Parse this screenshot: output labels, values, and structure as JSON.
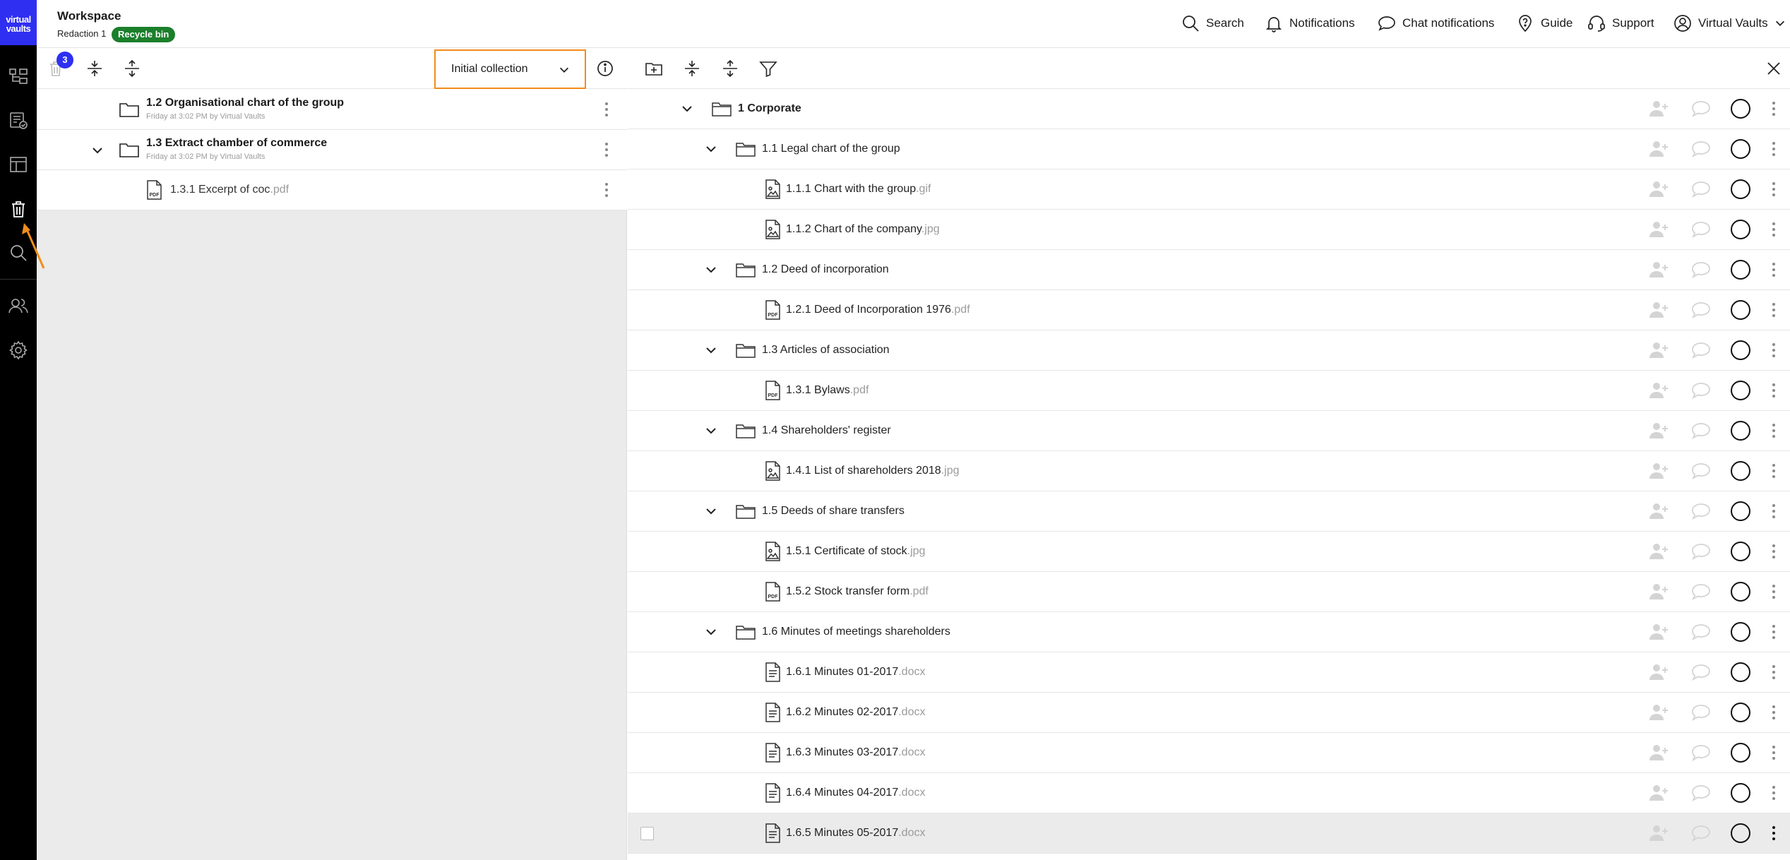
{
  "app": {
    "logo_line1": "virtual",
    "logo_line2": "vaults",
    "workspace_title": "Workspace",
    "workspace_sub": "Redaction 1",
    "workspace_badge": "Recycle bin"
  },
  "header_nav": {
    "search": "Search",
    "notifications": "Notifications",
    "chat_notifications": "Chat notifications",
    "guide": "Guide",
    "support": "Support",
    "account": "Virtual Vaults"
  },
  "left_toolbar": {
    "bin_count": "3",
    "collection_selected": "Initial collection"
  },
  "left_rows": [
    {
      "title": "1.2 Organisational chart of the group",
      "meta": "Friday at 3:02 PM by Virtual Vaults"
    },
    {
      "title": "1.3 Extract chamber of commerce",
      "meta": "Friday at 3:02 PM by Virtual Vaults"
    },
    {
      "name": "1.3.1 Excerpt of coc",
      "ext": ".pdf"
    }
  ],
  "tree": [
    {
      "name": "1 Corporate",
      "ext": "",
      "type": "folder",
      "level": 0
    },
    {
      "name": "1.1 Legal chart of the group",
      "ext": "",
      "type": "folder",
      "level": 1
    },
    {
      "name": "1.1.1 Chart with the group",
      "ext": ".gif",
      "type": "image",
      "level": 2
    },
    {
      "name": "1.1.2 Chart of the company",
      "ext": ".jpg",
      "type": "image",
      "level": 2
    },
    {
      "name": "1.2 Deed of incorporation",
      "ext": "",
      "type": "folder",
      "level": 1
    },
    {
      "name": "1.2.1 Deed of Incorporation 1976",
      "ext": ".pdf",
      "type": "pdf",
      "level": 2
    },
    {
      "name": "1.3 Articles of association",
      "ext": "",
      "type": "folder",
      "level": 1
    },
    {
      "name": "1.3.1 Bylaws",
      "ext": ".pdf",
      "type": "pdf",
      "level": 2
    },
    {
      "name": "1.4 Shareholders' register",
      "ext": "",
      "type": "folder",
      "level": 1
    },
    {
      "name": "1.4.1 List of shareholders 2018",
      "ext": ".jpg",
      "type": "image",
      "level": 2
    },
    {
      "name": "1.5 Deeds of share transfers",
      "ext": "",
      "type": "folder",
      "level": 1
    },
    {
      "name": "1.5.1 Certificate of stock",
      "ext": ".jpg",
      "type": "image",
      "level": 2
    },
    {
      "name": "1.5.2 Stock transfer form",
      "ext": ".pdf",
      "type": "pdf",
      "level": 2
    },
    {
      "name": "1.6 Minutes of meetings shareholders",
      "ext": "",
      "type": "folder",
      "level": 1
    },
    {
      "name": "1.6.1 Minutes 01-2017",
      "ext": ".docx",
      "type": "doc",
      "level": 2
    },
    {
      "name": "1.6.2 Minutes 02-2017",
      "ext": ".docx",
      "type": "doc",
      "level": 2
    },
    {
      "name": "1.6.3 Minutes 03-2017",
      "ext": ".docx",
      "type": "doc",
      "level": 2
    },
    {
      "name": "1.6.4 Minutes 04-2017",
      "ext": ".docx",
      "type": "doc",
      "level": 2
    },
    {
      "name": "1.6.5 Minutes 05-2017",
      "ext": ".docx",
      "type": "doc",
      "level": 2,
      "hovered": true
    }
  ],
  "icons": {
    "rail": [
      "tree-icon",
      "checklist-icon",
      "layout-icon",
      "trash-icon",
      "search-icon",
      "users-icon",
      "gear-icon"
    ],
    "accent": "#2f2ff2",
    "highlight": "#f28c1a",
    "badge_green": "#1b7f2b"
  }
}
